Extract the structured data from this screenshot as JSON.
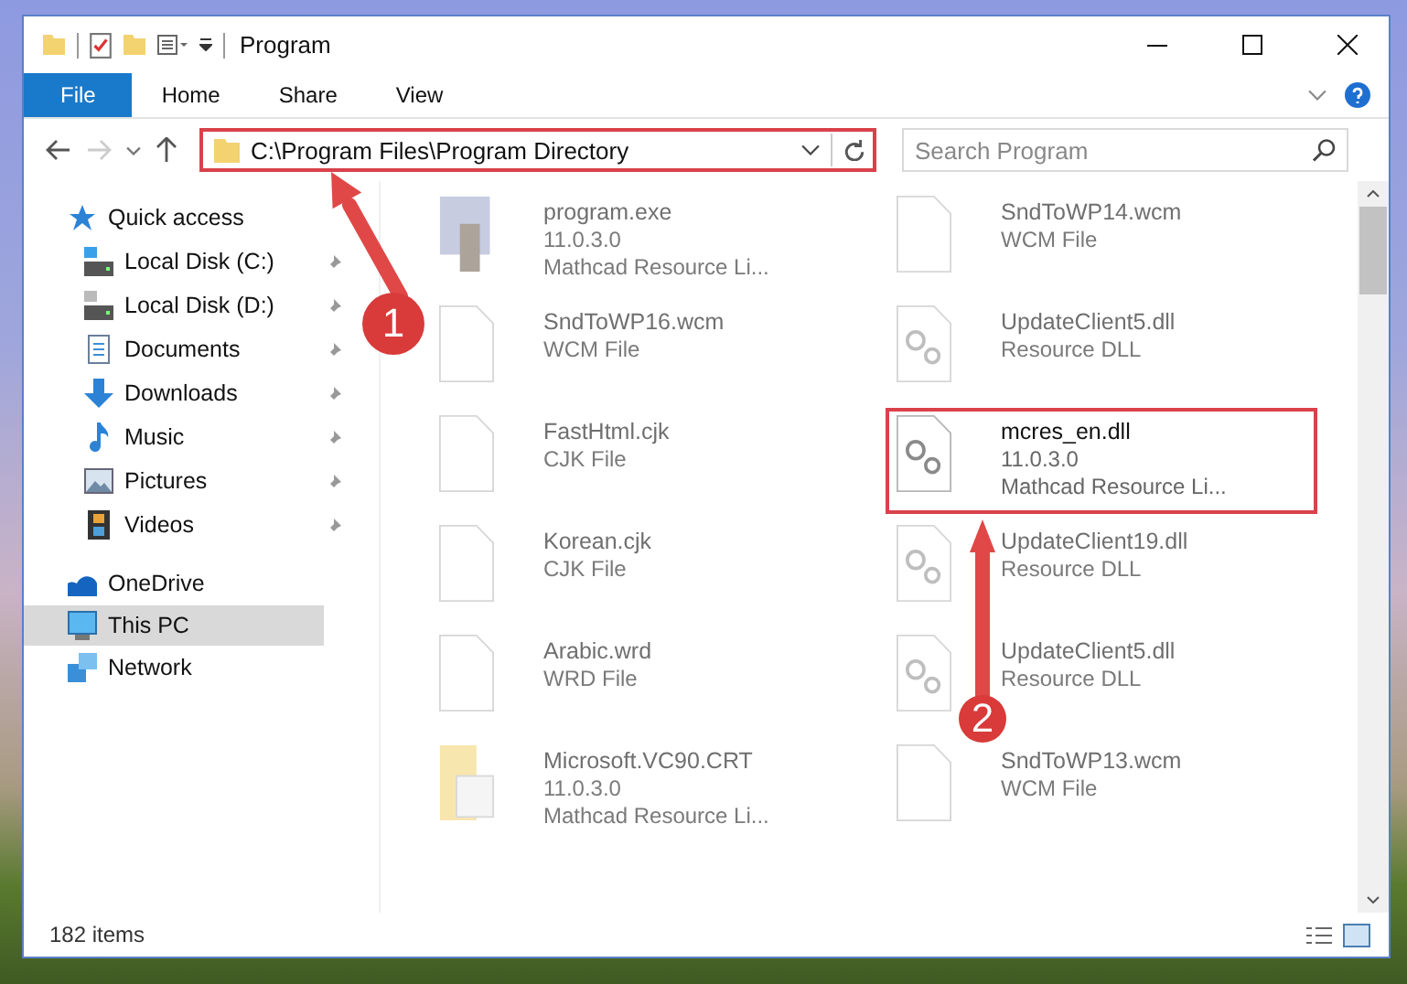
{
  "window": {
    "title": "Program"
  },
  "ribbon_tabs": [
    {
      "label": "File",
      "selected": true
    },
    {
      "label": "Home",
      "selected": false
    },
    {
      "label": "Share",
      "selected": false
    },
    {
      "label": "View",
      "selected": false
    }
  ],
  "address": {
    "path": "C:\\Program Files\\Program Directory",
    "highlighted": true
  },
  "search": {
    "placeholder": "Search Program"
  },
  "sidebar": {
    "items": [
      {
        "label": "Quick access",
        "selected": false,
        "children": [
          {
            "label": "Local Disk (C:)",
            "pinned": true
          },
          {
            "label": "Local Disk (D:)",
            "pinned": true
          },
          {
            "label": "Documents",
            "pinned": true
          },
          {
            "label": "Downloads",
            "pinned": true
          },
          {
            "label": "Music",
            "pinned": true
          },
          {
            "label": "Pictures",
            "pinned": true
          },
          {
            "label": "Videos",
            "pinned": true
          }
        ]
      },
      {
        "label": "OneDrive",
        "selected": false
      },
      {
        "label": "This PC",
        "selected": true
      },
      {
        "label": "Network",
        "selected": false
      }
    ]
  },
  "files": [
    {
      "name": "program.exe",
      "lines": [
        "11.0.3.0",
        "Mathcad Resource Li..."
      ],
      "kind": "exe",
      "faded": true,
      "highlighted": false
    },
    {
      "name": "SndToWP14.wcm",
      "lines": [
        "WCM File"
      ],
      "kind": "blank",
      "faded": true,
      "highlighted": false
    },
    {
      "name": "SndToWP16.wcm",
      "lines": [
        "WCM File"
      ],
      "kind": "blank",
      "faded": true,
      "highlighted": false
    },
    {
      "name": "UpdateClient5.dll",
      "lines": [
        "Resource DLL"
      ],
      "kind": "dll",
      "faded": true,
      "highlighted": false
    },
    {
      "name": "FastHtml.cjk",
      "lines": [
        "CJK File"
      ],
      "kind": "blank",
      "faded": true,
      "highlighted": false
    },
    {
      "name": "mcres_en.dll",
      "lines": [
        "11.0.3.0",
        "Mathcad Resource Li..."
      ],
      "kind": "dll",
      "faded": false,
      "highlighted": true
    },
    {
      "name": "Korean.cjk",
      "lines": [
        "CJK File"
      ],
      "kind": "blank",
      "faded": true,
      "highlighted": false
    },
    {
      "name": "UpdateClient19.dll",
      "lines": [
        "Resource DLL"
      ],
      "kind": "dll",
      "faded": true,
      "highlighted": false
    },
    {
      "name": "Arabic.wrd",
      "lines": [
        "WRD File"
      ],
      "kind": "blank",
      "faded": true,
      "highlighted": false
    },
    {
      "name": "UpdateClient5.dll",
      "lines": [
        "Resource DLL"
      ],
      "kind": "dll",
      "faded": true,
      "highlighted": false
    },
    {
      "name": "Microsoft.VC90.CRT",
      "lines": [
        "11.0.3.0",
        "Mathcad Resource Li..."
      ],
      "kind": "folder",
      "faded": true,
      "highlighted": false
    },
    {
      "name": "SndToWP13.wcm",
      "lines": [
        "WCM File"
      ],
      "kind": "blank",
      "faded": true,
      "highlighted": false
    }
  ],
  "status_bar": {
    "item_count": "182 items"
  },
  "annotations": [
    {
      "label": "1"
    },
    {
      "label": "2"
    }
  ]
}
